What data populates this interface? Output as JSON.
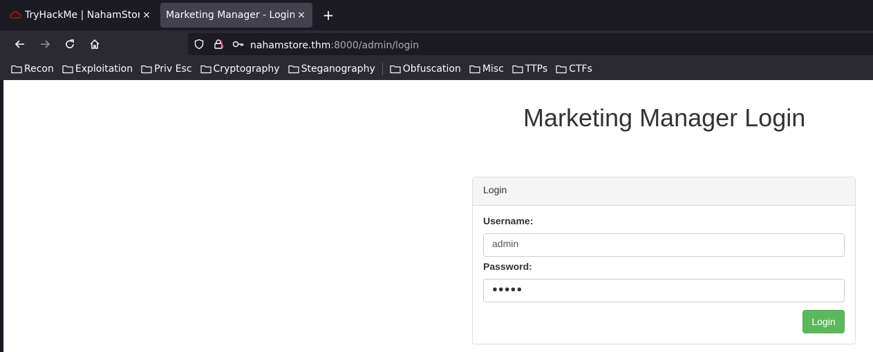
{
  "browser": {
    "tabs": [
      {
        "title": "TryHackMe | NahamStore",
        "active": false
      },
      {
        "title": "Marketing Manager - Login",
        "active": true
      }
    ],
    "close_glyph": "×",
    "new_tab_glyph": "+",
    "url": {
      "host": "nahamstore.thm",
      "path": ":8000/admin/login"
    },
    "bookmarks": [
      "Recon",
      "Exploitation",
      "Priv Esc",
      "Cryptography",
      "Steganography",
      "Obfuscation",
      "Misc",
      "TTPs",
      "CTFs"
    ],
    "colors": {
      "tab_bar": "#1c1b22",
      "toolbar": "#2b2a33",
      "active_tab": "#42414d",
      "text": "#fbfbfe",
      "lock_warning": "#e22850"
    }
  },
  "page": {
    "heading": "Marketing Manager Login",
    "panel_title": "Login",
    "username_label": "Username:",
    "username_value": "admin",
    "password_label": "Password:",
    "password_value": "●●●●●",
    "submit_label": "Login",
    "colors": {
      "button": "#5cb85c",
      "panel_heading": "#f5f5f5"
    }
  }
}
